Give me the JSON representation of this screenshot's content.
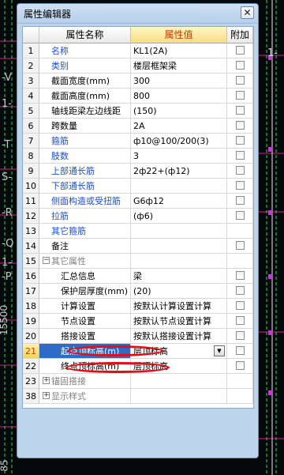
{
  "window": {
    "title": "属性编辑器",
    "close_label": "✕"
  },
  "header": {
    "name_col": "属性名称",
    "value_col": "属性值",
    "add_col": "附加"
  },
  "rows": [
    {
      "num": "1",
      "name": "名称",
      "value": "KL1(2A)"
    },
    {
      "num": "2",
      "name": "类别",
      "value": "楼层框架梁"
    },
    {
      "num": "3",
      "name": "截面宽度(mm)",
      "value": "300"
    },
    {
      "num": "4",
      "name": "截面高度(mm)",
      "value": "800"
    },
    {
      "num": "5",
      "name": "轴线距梁左边线距",
      "value": "(150)"
    },
    {
      "num": "6",
      "name": "跨数量",
      "value": "2A"
    },
    {
      "num": "7",
      "name": "箍筋",
      "value": "ф10@100/200(3)"
    },
    {
      "num": "8",
      "name": "肢数",
      "value": "3"
    },
    {
      "num": "9",
      "name": "上部通长筋",
      "value": "2ф22+(ф12)"
    },
    {
      "num": "10",
      "name": "下部通长筋",
      "value": ""
    },
    {
      "num": "11",
      "name": "侧面构造或受扭筋",
      "value": "G6ф12"
    },
    {
      "num": "12",
      "name": "拉筋",
      "value": "(ф6)"
    },
    {
      "num": "13",
      "name": "其它箍筋",
      "value": ""
    },
    {
      "num": "14",
      "name": "备注",
      "value": ""
    },
    {
      "num": "15",
      "name": "其它属性",
      "value": ""
    },
    {
      "num": "16",
      "name": "汇总信息",
      "value": "梁"
    },
    {
      "num": "17",
      "name": "保护层厚度(mm)",
      "value": "(20)"
    },
    {
      "num": "18",
      "name": "计算设置",
      "value": "按默认计算设置计算"
    },
    {
      "num": "19",
      "name": "节点设置",
      "value": "按默认节点设置计算"
    },
    {
      "num": "20",
      "name": "搭接设置",
      "value": "按默认搭接设置计算"
    },
    {
      "num": "21",
      "name": "起点顶标高(m)",
      "value": "层顶标高"
    },
    {
      "num": "22",
      "name": "终点顶标高(m)",
      "value": "层顶标高"
    },
    {
      "num": "23",
      "name": "锚固搭接",
      "value": ""
    },
    {
      "num": "38",
      "name": "显示样式",
      "value": ""
    }
  ],
  "cad": {
    "left_labels": [
      "-V",
      "1-",
      "-T",
      "S-",
      "-R",
      "-Q",
      "1-",
      "-P",
      "15500",
      "85"
    ],
    "right_labels": [
      "1-"
    ]
  },
  "colors": {
    "link_blue": "#1f4fc8",
    "selection": "#2e6bc8",
    "annotation_red": "#e0101a",
    "panel": "#bcd4ec"
  }
}
